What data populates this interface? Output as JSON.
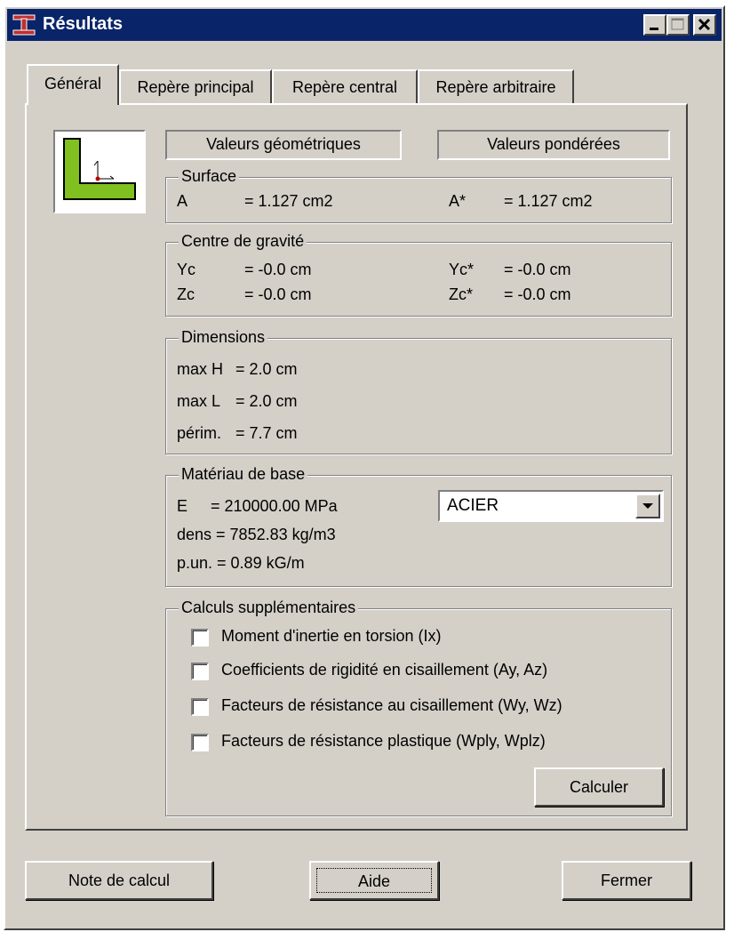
{
  "window": {
    "title": "Résultats",
    "accent_color": "#0a246a",
    "icon": "section-profile-icon"
  },
  "tabs": [
    {
      "label": "Général",
      "active": true
    },
    {
      "label": "Repère principal",
      "active": false
    },
    {
      "label": "Repère central",
      "active": false
    },
    {
      "label": "Repère arbitraire",
      "active": false
    }
  ],
  "headers": {
    "geometric": "Valeurs géométriques",
    "weighted": "Valeurs pondérées"
  },
  "surface": {
    "legend": "Surface",
    "a_label": "A",
    "a_value": "= 1.127 cm2",
    "a_star_label": "A*",
    "a_star_value": "= 1.127 cm2"
  },
  "centre": {
    "legend": "Centre de gravité",
    "yc_label": "Yc",
    "yc_value": "= -0.0 cm",
    "zc_label": "Zc",
    "zc_value": "= -0.0 cm",
    "yc_star_label": "Yc*",
    "yc_star_value": "= -0.0 cm",
    "zc_star_label": "Zc*",
    "zc_star_value": "= -0.0 cm"
  },
  "dimensions": {
    "legend": "Dimensions",
    "max_h_label": "max H",
    "max_h_value": "= 2.0 cm",
    "max_l_label": "max L",
    "max_l_value": "= 2.0 cm",
    "perim_label": "périm.",
    "perim_value": "= 7.7 cm"
  },
  "materiau": {
    "legend": "Matériau de base",
    "e_label": "E",
    "e_value": "= 210000.00 MPa",
    "dens": "dens = 7852.83 kg/m3",
    "pun": "p.un. = 0.89 kG/m",
    "selected": "ACIER"
  },
  "calculs": {
    "legend": "Calculs supplémentaires",
    "options": [
      {
        "label": "Moment d'inertie en torsion (Ix)",
        "checked": false
      },
      {
        "label": "Coefficients de rigidité en cisaillement (Ay, Az)",
        "checked": false
      },
      {
        "label": "Facteurs de résistance au cisaillement (Wy, Wz)",
        "checked": false
      },
      {
        "label": "Facteurs de résistance plastique (Wply, Wplz)",
        "checked": false
      }
    ],
    "calculate_label": "Calculer"
  },
  "footer": {
    "note_label": "Note de calcul",
    "help_label": "Aide",
    "close_label": "Fermer"
  },
  "colors": {
    "profile_fill": "#80c020",
    "face": "#d4d0c8"
  }
}
